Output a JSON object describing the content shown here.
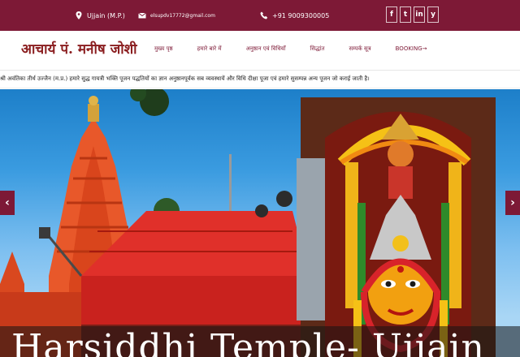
{
  "topbar": {
    "location": "Ujjain (M.P.)",
    "email": "elsupdv17772@gmail.com",
    "phone": "+91 9009300005",
    "social": [
      "f",
      "t",
      "in",
      "y"
    ],
    "bg_color": "#7d1936"
  },
  "brand": {
    "logo_text": "आचार्य पं. मनीष जोशी"
  },
  "nav": {
    "items": [
      "मुख्य पृष्ठ",
      "हमारे बारे में",
      "अनुष्ठान एवं विधियाँ",
      "सिद्धांत",
      "सम्पर्क सूत्र",
      "BOOKING→"
    ]
  },
  "ticker": {
    "text": "श्री अवंतिका तीर्थ उज्जैन (म.प्र.) हमारे सुद्ध गायत्री भक्ति पूजन पद्धतियों का ज्ञान अनुष्ठानपूर्वक सब व्यवस्थायें और विधि दीक्षा पूजा एवं हमारे सुसम्पन्न अन्य पूजन जो कराई जाती है।"
  },
  "hero": {
    "caption": "Harsiddhi Temple- Ujjain",
    "prev": "‹",
    "next": "›"
  }
}
